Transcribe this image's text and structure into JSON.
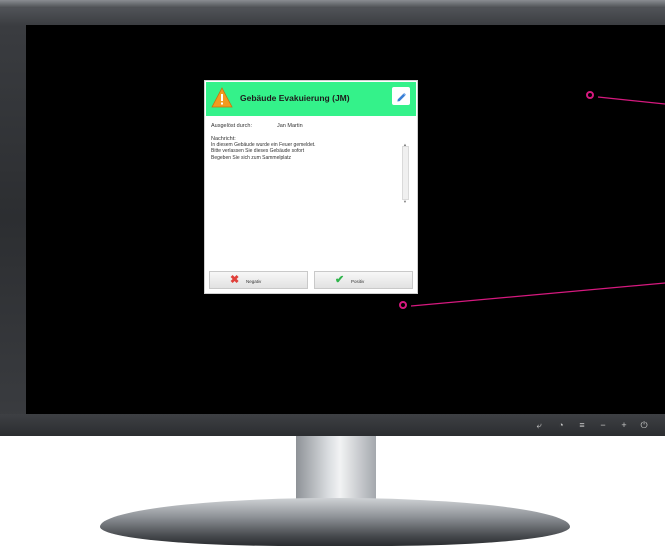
{
  "dialog": {
    "title": "Gebäude Evakuierung (JM)",
    "triggered_by_label": "Ausgelöst durch:",
    "triggered_by_value": "Jan Martin",
    "message_label": "Nachricht:",
    "message_lines": [
      "In diesem Gebäude wurde ein Feuer gemeldet.",
      "Bitte verlassen Sie dieses Gebäude sofort",
      "Begeben Sie sich zum Sammelplatz"
    ],
    "negative_label": "Negativ",
    "positive_label": "Positiv"
  },
  "colors": {
    "header_green": "#34f28a",
    "screen": "#000000",
    "annotation": "#d6197f",
    "negative_icon": "#e0403a",
    "positive_icon": "#2fb54b",
    "edit_icon": "#3a7fd6"
  },
  "icons": {
    "header": "warning-triangle-icon",
    "edit": "pencil-icon",
    "negative": "red-x-icon",
    "positive": "green-check-icon"
  },
  "monitor_controls": [
    "return-icon",
    "brightness-icon",
    "menu-icon",
    "minus-icon",
    "plus-icon",
    "power-icon"
  ]
}
